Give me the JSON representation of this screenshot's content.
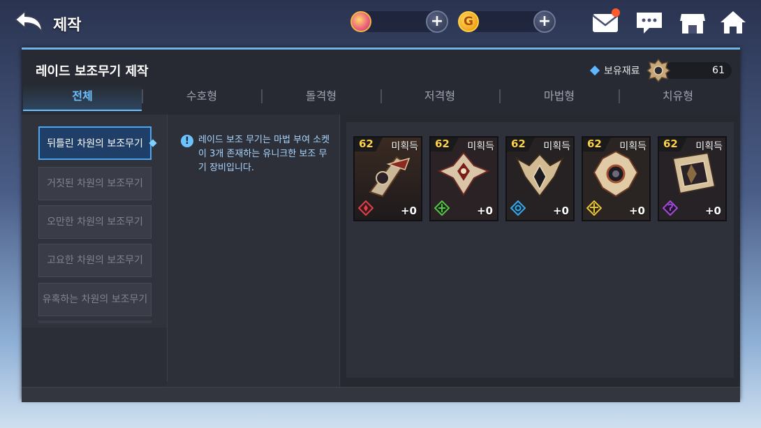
{
  "header": {
    "title": "제작"
  },
  "currencies": [
    {
      "icon": "gem-coin-icon",
      "value": ""
    },
    {
      "icon": "gold-coin-icon",
      "symbol": "G",
      "value": ""
    }
  ],
  "panel": {
    "title": "레이드 보조무기 제작",
    "material": {
      "label": "보유재료",
      "count": "61"
    },
    "tabs": [
      {
        "label": "전체",
        "active": true
      },
      {
        "label": "수호형"
      },
      {
        "label": "돌격형"
      },
      {
        "label": "저격형"
      },
      {
        "label": "마법형"
      },
      {
        "label": "치유형"
      }
    ]
  },
  "list": [
    {
      "label": "뒤틀린 차원의 보조무기",
      "active": true
    },
    {
      "label": "거짓된 차원의 보조무기"
    },
    {
      "label": "오만한 차원의 보조무기"
    },
    {
      "label": "고요한 차원의 보조무기"
    },
    {
      "label": "유혹하는 차원의 보조무기"
    }
  ],
  "description": {
    "info_symbol": "!",
    "text": "레이드 보조 무기는 마법 부여 소켓이 3개 존재하는 유니크한 보조 무기 장비입니다."
  },
  "items": [
    {
      "level": "62",
      "status": "미획득",
      "enhance": "+0",
      "type_color": "#e0404a",
      "type_icon": "guardian-type-icon"
    },
    {
      "level": "62",
      "status": "미획득",
      "enhance": "+0",
      "type_color": "#58c24a",
      "type_icon": "assault-type-icon"
    },
    {
      "level": "62",
      "status": "미획득",
      "enhance": "+0",
      "type_color": "#3aa6e8",
      "type_icon": "sniper-type-icon"
    },
    {
      "level": "62",
      "status": "미획득",
      "enhance": "+0",
      "type_color": "#e8c33a",
      "type_icon": "magic-type-icon"
    },
    {
      "level": "62",
      "status": "미획득",
      "enhance": "+0",
      "type_color": "#a24ad8",
      "type_icon": "healer-type-icon"
    }
  ]
}
